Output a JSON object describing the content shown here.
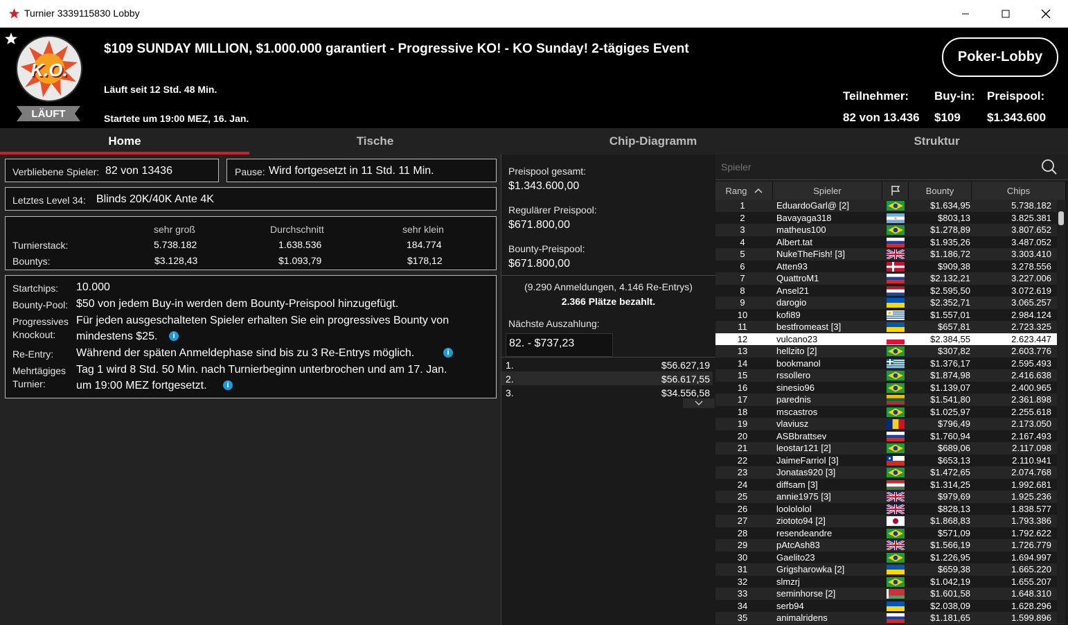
{
  "window": {
    "title": "Turnier 3339115830 Lobby"
  },
  "header": {
    "title": "$109 SUNDAY MILLION, $1.000.000 garantiert - Progressive KO! - KO Sunday! 2-tägiges Event",
    "running": "Läuft seit 12 Std. 48 Min.",
    "started": "Startete um 19:00 MEZ, 16. Jan.",
    "badge_logo": "K.O.",
    "status": "LÄUFT",
    "lobby_button": "Poker-Lobby",
    "entrants_label": "Teilnehmer:",
    "entrants_value": "82 von 13.436",
    "buyin_label": "Buy-in:",
    "buyin_value": "$109",
    "prizepool_label": "Preispool:",
    "prizepool_value": "$1.343.600"
  },
  "tabs": [
    "Home",
    "Tische",
    "Chip-Diagramm",
    "Struktur"
  ],
  "home": {
    "remaining_label": "Verbliebene Spieler:",
    "remaining_value": "82 von 13436",
    "pause_label": "Pause:",
    "pause_value": "Wird fortgesetzt in 11 Std. 11 Min.",
    "level_label": "Letztes Level 34:",
    "level_value": "Blinds 20K/40K Ante 4K",
    "stack_headers": [
      "sehr groß",
      "Durchschnitt",
      "sehr klein"
    ],
    "stack_label": "Turnierstack:",
    "stack_values": [
      "5.738.182",
      "1.638.536",
      "184.774"
    ],
    "bounty_label": "Bountys:",
    "bounty_values": [
      "$3.128,43",
      "$1.093,79",
      "$178,12"
    ],
    "startchips_label": "Startchips:",
    "startchips_value": "10.000",
    "bountypool_label": "Bounty-Pool:",
    "bountypool_value": "$50 von jedem Buy-in werden dem Bounty-Preispool hinzugefügt.",
    "pko_label1": "Progressives",
    "pko_label2": "Knockout:",
    "pko_value1": "Für jeden ausgeschalteten Spieler erhalten Sie ein progressives Bounty von",
    "pko_value2": "mindestens $25.",
    "reentry_label": "Re-Entry:",
    "reentry_value": "Während der späten Anmeldephase sind bis zu 3 Re-Entrys möglich.",
    "multiday_label1": "Mehrtägiges",
    "multiday_label2": "Turnier:",
    "multiday_value1": "Tag 1 wird 8 Std. 50 Min. nach Turnierbeginn unterbrochen und am 17. Jan.",
    "multiday_value2": "um 19:00 MEZ fortgesetzt.",
    "info_icon": "i"
  },
  "prizes": {
    "total_label": "Preispool gesamt:",
    "total_value": "$1.343.600,00",
    "regular_label": "Regulärer Preispool:",
    "regular_value": "$671.800,00",
    "bounty_label": "Bounty-Preispool:",
    "bounty_value": "$671.800,00",
    "entries": "(9.290 Anmeldungen, 4.146 Re-Entrys)",
    "paid": "2.366 Plätze bezahlt.",
    "next_label": "Nächste Auszahlung:",
    "next_value": "82. - $737,23",
    "payouts": [
      {
        "place": "1.",
        "amount": "$56.627,19"
      },
      {
        "place": "2.",
        "amount": "$56.617,55"
      },
      {
        "place": "3.",
        "amount": "$34.556,58"
      }
    ]
  },
  "players": {
    "search_placeholder": "Spieler",
    "columns": [
      "Rang",
      "Spieler",
      "Bounty",
      "Chips"
    ],
    "rows": [
      {
        "rank": "1",
        "name": "EduardoGarl@ [2]",
        "flag": "BR",
        "bounty": "$1.634,95",
        "chips": "5.738.182"
      },
      {
        "rank": "2",
        "name": "Bavayaga318",
        "flag": "AR",
        "bounty": "$803,13",
        "chips": "3.825.381"
      },
      {
        "rank": "3",
        "name": "matheus100",
        "flag": "BR",
        "bounty": "$1.278,89",
        "chips": "3.807.652"
      },
      {
        "rank": "4",
        "name": "Albert.tat",
        "flag": "RU",
        "bounty": "$1.935,26",
        "chips": "3.487.052"
      },
      {
        "rank": "5",
        "name": "NukeTheFish! [3]",
        "flag": "GB",
        "bounty": "$1.186,72",
        "chips": "3.303.410"
      },
      {
        "rank": "6",
        "name": "Atten93",
        "flag": "DK",
        "bounty": "$909,38",
        "chips": "3.278.556"
      },
      {
        "rank": "7",
        "name": "QuattroM1",
        "flag": "RU",
        "bounty": "$2.132,21",
        "chips": "3.227.006"
      },
      {
        "rank": "8",
        "name": "Ansel21",
        "flag": "NL",
        "bounty": "$2.595,50",
        "chips": "3.072.619"
      },
      {
        "rank": "9",
        "name": "darogio",
        "flag": "UA",
        "bounty": "$2.352,71",
        "chips": "3.065.257"
      },
      {
        "rank": "10",
        "name": "kofi89",
        "flag": "UY",
        "bounty": "$1.557,01",
        "chips": "2.984.124"
      },
      {
        "rank": "11",
        "name": "bestfromeast [3]",
        "flag": "UA",
        "bounty": "$657,81",
        "chips": "2.723.325"
      },
      {
        "rank": "12",
        "name": "vulcano23",
        "flag": "PL",
        "bounty": "$2.384,55",
        "chips": "2.623.447"
      },
      {
        "rank": "13",
        "name": "hellzito [2]",
        "flag": "BR",
        "bounty": "$307,82",
        "chips": "2.603.776"
      },
      {
        "rank": "14",
        "name": "bookmanol",
        "flag": "GR",
        "bounty": "$1.376,17",
        "chips": "2.595.493"
      },
      {
        "rank": "15",
        "name": "rssollero",
        "flag": "BR",
        "bounty": "$1.874,98",
        "chips": "2.416.638"
      },
      {
        "rank": "16",
        "name": "sinesio96",
        "flag": "BR",
        "bounty": "$1.139,07",
        "chips": "2.400.965"
      },
      {
        "rank": "17",
        "name": "parednis",
        "flag": "LT",
        "bounty": "$1.541,80",
        "chips": "2.361.898"
      },
      {
        "rank": "18",
        "name": "mscastros",
        "flag": "BR",
        "bounty": "$1.025,97",
        "chips": "2.255.618"
      },
      {
        "rank": "19",
        "name": "vlaviusz",
        "flag": "RO",
        "bounty": "$796,49",
        "chips": "2.173.050"
      },
      {
        "rank": "20",
        "name": "ASBbrattsev",
        "flag": "RU",
        "bounty": "$1.760,94",
        "chips": "2.167.493"
      },
      {
        "rank": "21",
        "name": "leostar121 [2]",
        "flag": "BR",
        "bounty": "$689,06",
        "chips": "2.117.098"
      },
      {
        "rank": "22",
        "name": "JaimeFarriol [3]",
        "flag": "CL",
        "bounty": "$653,13",
        "chips": "2.110.941"
      },
      {
        "rank": "23",
        "name": "Jonatas920 [3]",
        "flag": "BR",
        "bounty": "$1.472,65",
        "chips": "2.074.768"
      },
      {
        "rank": "24",
        "name": "diffsam [3]",
        "flag": "HU",
        "bounty": "$1.314,25",
        "chips": "1.992.681"
      },
      {
        "rank": "25",
        "name": "annie1975 [3]",
        "flag": "GB",
        "bounty": "$979,69",
        "chips": "1.925.236"
      },
      {
        "rank": "26",
        "name": "loolololol",
        "flag": "GB",
        "bounty": "$828,13",
        "chips": "1.838.577"
      },
      {
        "rank": "27",
        "name": "ziototo94 [2]",
        "flag": "JP",
        "bounty": "$1.868,83",
        "chips": "1.793.386"
      },
      {
        "rank": "28",
        "name": "resendeandre",
        "flag": "BR",
        "bounty": "$571,09",
        "chips": "1.792.622"
      },
      {
        "rank": "29",
        "name": "pAtcAsh83",
        "flag": "GB",
        "bounty": "$1.566,19",
        "chips": "1.726.779"
      },
      {
        "rank": "30",
        "name": "Gaelito23",
        "flag": "BR",
        "bounty": "$1.226,95",
        "chips": "1.694.997"
      },
      {
        "rank": "31",
        "name": "Grigsharowka [2]",
        "flag": "UA",
        "bounty": "$659,38",
        "chips": "1.665.220"
      },
      {
        "rank": "32",
        "name": "slmzrj",
        "flag": "BR",
        "bounty": "$1.042,19",
        "chips": "1.655.207"
      },
      {
        "rank": "33",
        "name": "seminhorse [2]",
        "flag": "BY",
        "bounty": "$1.601,58",
        "chips": "1.648.310"
      },
      {
        "rank": "34",
        "name": "serb94",
        "flag": "UA",
        "bounty": "$2.038,09",
        "chips": "1.628.296"
      },
      {
        "rank": "35",
        "name": "animalridens",
        "flag": "RU",
        "bounty": "$1.181,65",
        "chips": "1.599.896"
      }
    ],
    "selected_rank": "12"
  },
  "colors": {
    "accent": "#c8202e",
    "header_bg": "#000000",
    "panel_bg": "#232323"
  }
}
